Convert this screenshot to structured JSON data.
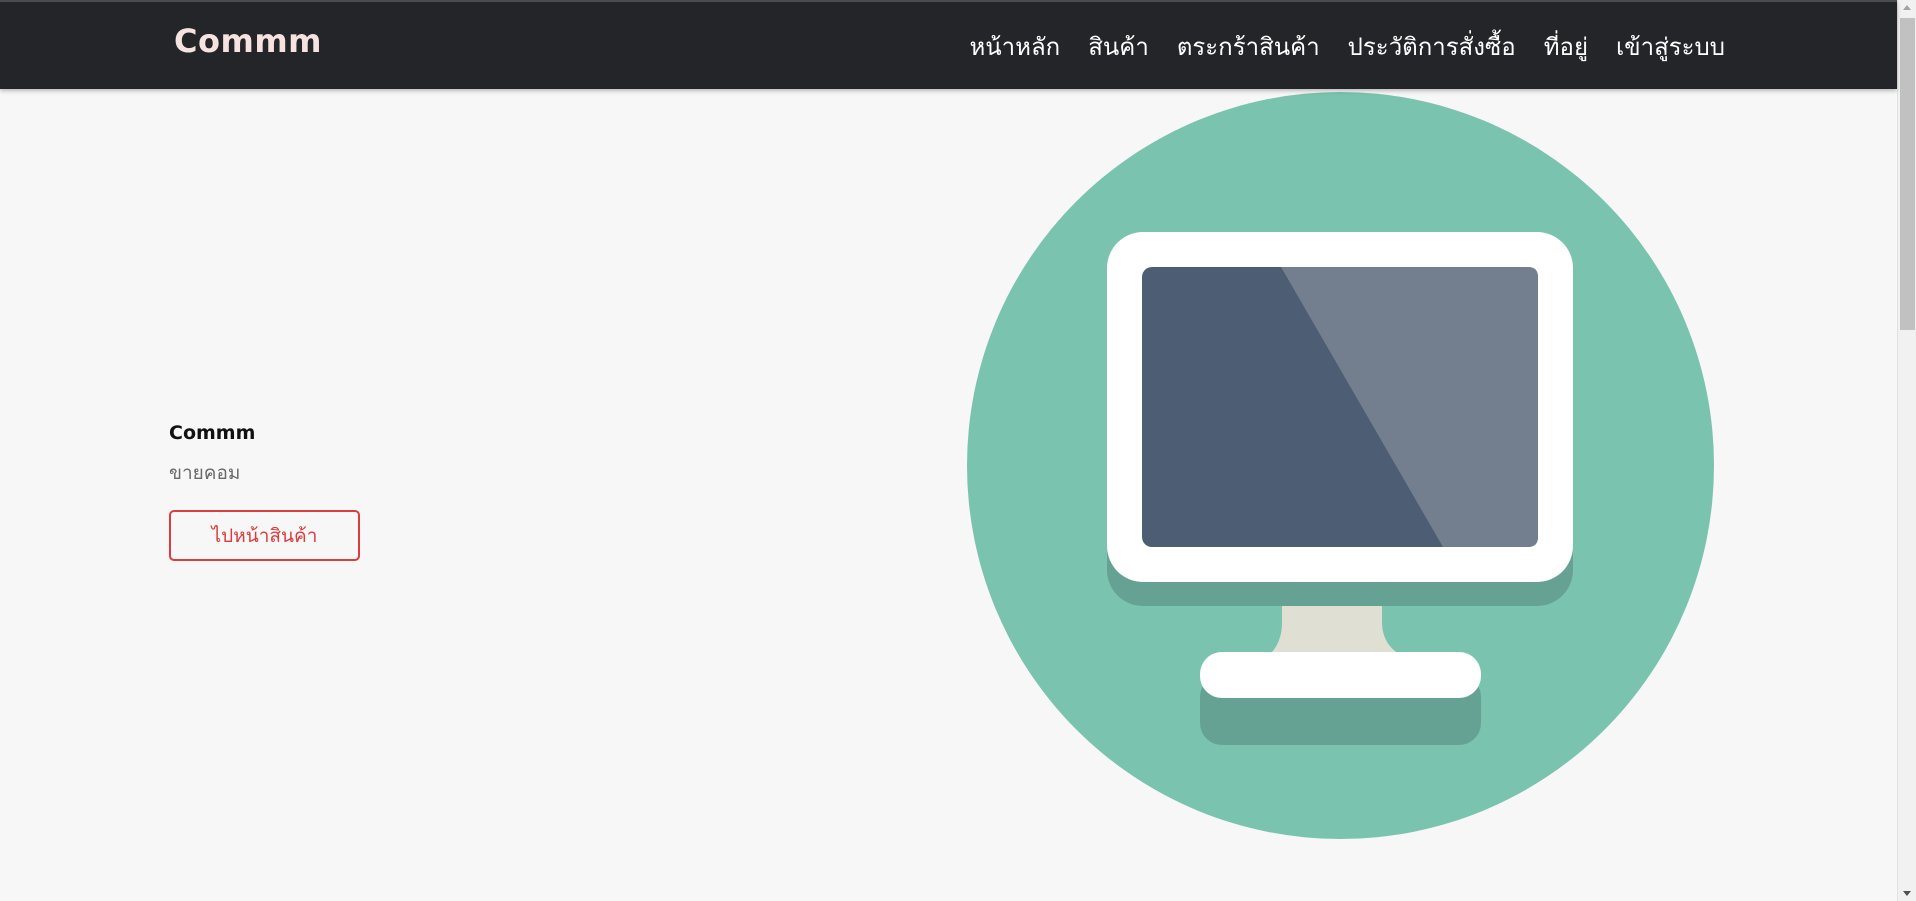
{
  "navbar": {
    "brand": "Commm",
    "links": [
      {
        "label": "หน้าหลัก"
      },
      {
        "label": "สินค้า"
      },
      {
        "label": "ตระกร้าสินค้า"
      },
      {
        "label": "ประวัติการสั่งซื้อ"
      },
      {
        "label": "ที่อยู่"
      },
      {
        "label": "เข้าสู่ระบบ"
      }
    ]
  },
  "hero": {
    "title": "Commm",
    "subtitle": "ขายคอม",
    "button_label": "ไปหน้าสินค้า"
  },
  "illustration": {
    "icon": "computer-monitor-icon",
    "colors": {
      "circle": "#79c3af",
      "screen_dark": "#4d5d74",
      "screen_light": "#737e8f",
      "frame": "#ffffff",
      "stand": "#dfe0d3",
      "shadow": "#66a293"
    }
  },
  "colors": {
    "navbar_bg": "#232529",
    "brand": "#f6e3e0",
    "accent": "#dc3c3c",
    "page_bg": "#f7f7f7"
  }
}
